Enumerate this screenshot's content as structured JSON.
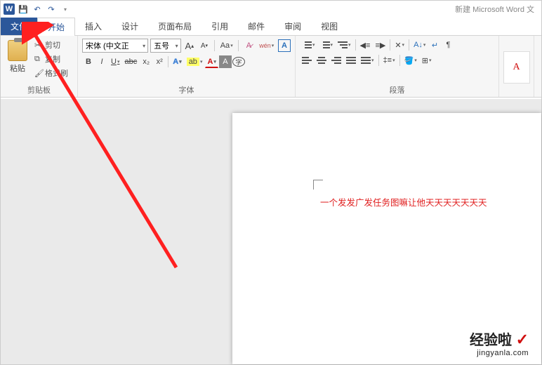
{
  "title": "新建 Microsoft Word 文",
  "tabs": {
    "file": "文件",
    "home": "开始",
    "insert": "插入",
    "design": "设计",
    "layout": "页面布局",
    "references": "引用",
    "mailings": "邮件",
    "review": "审阅",
    "view": "视图"
  },
  "clipboard": {
    "cut": "剪切",
    "copy": "复制",
    "paste": "粘贴",
    "format_painter": "格式刷",
    "group_label": "剪贴板"
  },
  "font": {
    "font_name": "宋体 (中文正",
    "font_size": "五号",
    "grow": "A",
    "shrink": "A",
    "change_case": "Aa",
    "clear": "A",
    "pinyin": "wén",
    "bold": "B",
    "italic": "I",
    "underline": "U",
    "strike": "abc",
    "sub": "x₂",
    "sup": "x²",
    "effects": "A",
    "highlight": "ab",
    "color": "A",
    "shading": "A",
    "border": "字",
    "group_label": "字体"
  },
  "para": {
    "group_label": "段落"
  },
  "document_text": "一个发发广发任务图嘛让他天天天天天天天",
  "watermark": {
    "line1": "经验啦",
    "check": "✓",
    "line2": "jingyanla.com"
  }
}
